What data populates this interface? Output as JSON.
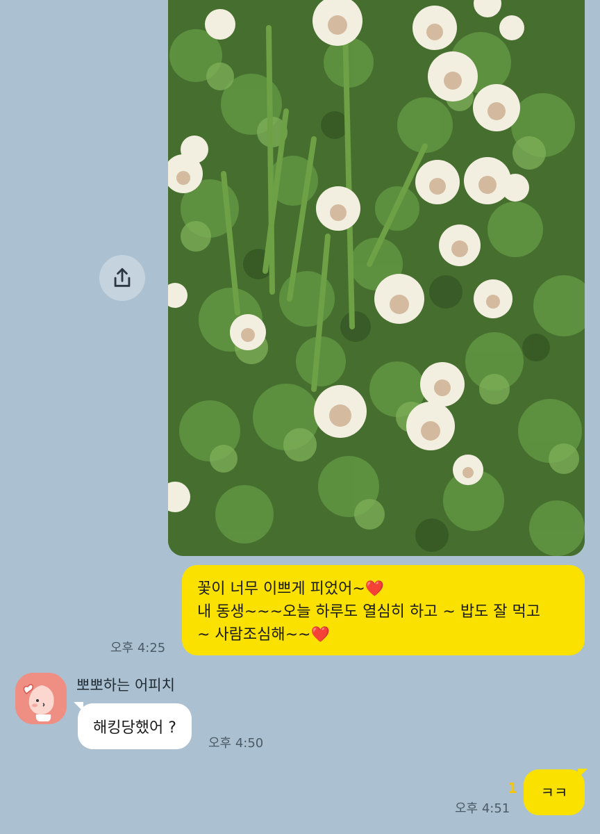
{
  "chat": {
    "photo_message": {
      "image_description": "white clover flowers among green leaves",
      "share_icon": "share-icon"
    },
    "my_text_message": {
      "lines": [
        "꽃이 너무 이쁘게 피었어~",
        "내 동생~~~오늘 하루도 열심히 하고 ~ 밥도 잘 먹고",
        "~ 사람조심해~~"
      ],
      "emoji": "❤️",
      "time": "오후 4:25"
    },
    "incoming_message": {
      "sender_name": "뽀뽀하는 어피치",
      "text": "해킹당했어 ?",
      "time": "오후 4:50",
      "avatar_icon": "apeach-avatar-icon"
    },
    "my_reply": {
      "text": "ㅋㅋ",
      "unread_count": "1",
      "time": "오후 4:51"
    }
  },
  "colors": {
    "background": "#abc1d1",
    "my_bubble": "#fae100",
    "other_bubble": "#ffffff",
    "unread": "#f7c600"
  }
}
